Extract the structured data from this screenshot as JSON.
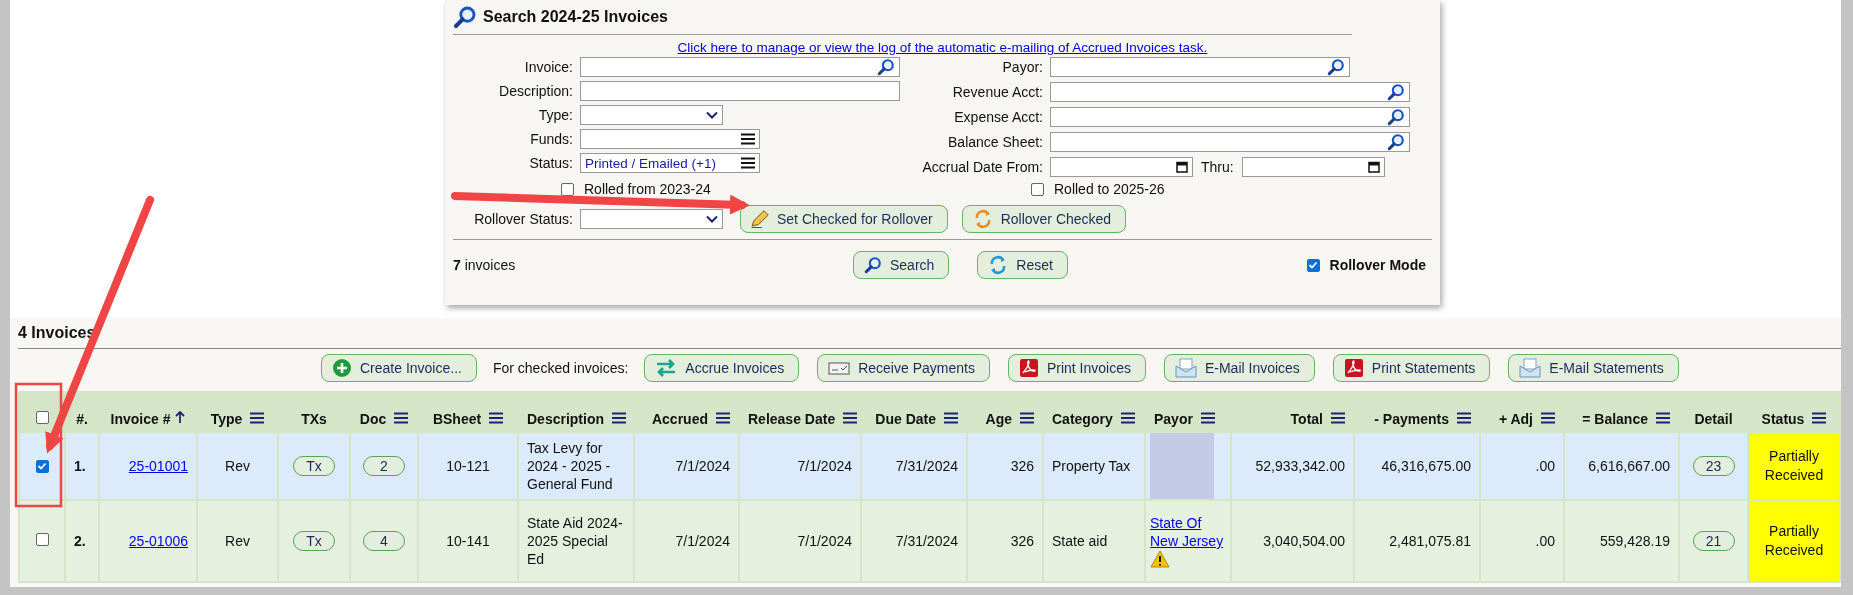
{
  "search": {
    "title": "Search 2024-25 Invoices",
    "link": "Click here to manage or view the log of the automatic e-mailing of Accrued Invoices task.",
    "left_fields": [
      {
        "label": "Invoice:",
        "kind": "search"
      },
      {
        "label": "Description:",
        "kind": "text"
      },
      {
        "label": "Type:",
        "kind": "select"
      },
      {
        "label": "Funds:",
        "kind": "multi"
      },
      {
        "label": "Status:",
        "kind": "multi",
        "value": "Printed / Emailed (+1)"
      }
    ],
    "right_fields": [
      {
        "label": "Payor:",
        "kind": "search"
      },
      {
        "label": "Revenue Acct:",
        "kind": "search_wide"
      },
      {
        "label": "Expense Acct:",
        "kind": "search_wide"
      },
      {
        "label": "Balance Sheet:",
        "kind": "search_wide"
      },
      {
        "label": "Accrual Date From:",
        "kind": "date",
        "second_label": "Thru:"
      }
    ],
    "rolled_from": {
      "label": "Rolled from 2023-24",
      "checked": false
    },
    "rolled_to": {
      "label": "Rolled to 2025-26",
      "checked": false
    },
    "rollover_status": {
      "label": "Rollover Status:"
    },
    "rollover_buttons": [
      {
        "label": "Set Checked for Rollover",
        "kind": "pencil"
      },
      {
        "label": "Rollover Checked",
        "kind": "rollover"
      }
    ],
    "count": "**7** invoices",
    "actions": [
      {
        "label": "Search",
        "kind": "search"
      },
      {
        "label": "Reset",
        "kind": "reset"
      }
    ],
    "rollover_mode": {
      "label": "Rollover Mode",
      "checked": true
    }
  },
  "results": {
    "title": "4 Invoices",
    "create_button": "Create Invoice...",
    "checked_label": "For checked invoices:",
    "toolbar": [
      {
        "label": "Accrue Invoices",
        "kind": "accrue"
      },
      {
        "label": "Receive Payments",
        "kind": "payment"
      },
      {
        "label": "Print Invoices",
        "kind": "pdf"
      },
      {
        "label": "E-Mail Invoices",
        "kind": "mail"
      },
      {
        "label": "Print Statements",
        "kind": "pdf"
      },
      {
        "label": "E-Mail Statements",
        "kind": "mail"
      }
    ],
    "select_all": {
      "checked": false
    },
    "columns": [
      {
        "label": "#.",
        "menu": false
      },
      {
        "label": "Invoice #",
        "menu": false,
        "sorted": true
      },
      {
        "label": "Type",
        "menu": true
      },
      {
        "label": "TXs",
        "menu": false
      },
      {
        "label": "Doc",
        "menu": true
      },
      {
        "label": "BSheet",
        "menu": true
      },
      {
        "label": "Description",
        "menu": true
      },
      {
        "label": "Accrued",
        "menu": true
      },
      {
        "label": "Release Date",
        "menu": true
      },
      {
        "label": "Due Date",
        "menu": true
      },
      {
        "label": "Age",
        "menu": true
      },
      {
        "label": "Category",
        "menu": true
      },
      {
        "label": "Payor",
        "menu": true
      },
      {
        "label": "Total",
        "menu": true
      },
      {
        "label": "- Payments",
        "menu": true
      },
      {
        "label": "+ Adj",
        "menu": true
      },
      {
        "label": "= Balance",
        "menu": true
      },
      {
        "label": "Detail",
        "menu": false
      },
      {
        "label": "Status",
        "menu": true
      }
    ],
    "rows": [
      {
        "selected": true,
        "checked": true,
        "number": "1.",
        "invoice": "25-01001",
        "type": "Rev",
        "txs": "Tx",
        "doc": "2",
        "bsheet": "10-121",
        "description": "Tax Levy for 2024 - 2025 - General Fund",
        "accrued": "7/1/2024",
        "release": "7/1/2024",
        "due": "7/31/2024",
        "age": "326",
        "category": "Property Tax",
        "payor": {
          "redacted": true,
          "warning": false
        },
        "total": "52,933,342.00",
        "payments": "46,316,675.00",
        "adj": ".00",
        "balance": "6,616,667.00",
        "detail": "23",
        "status": "Partially Received"
      },
      {
        "selected": false,
        "checked": false,
        "number": "2.",
        "invoice": "25-01006",
        "type": "Rev",
        "txs": "Tx",
        "doc": "4",
        "bsheet": "10-141",
        "description": "State Aid 2024-2025 Special Ed",
        "accrued": "7/1/2024",
        "release": "7/1/2024",
        "due": "7/31/2024",
        "age": "326",
        "category": "State aid",
        "payor": {
          "redacted": false,
          "name": "State Of New Jersey",
          "warning": true
        },
        "total": "3,040,504.00",
        "payments": "2,481,075.81",
        "adj": ".00",
        "balance": "559,428.19",
        "detail": "21",
        "status": "Partially Received"
      }
    ]
  }
}
